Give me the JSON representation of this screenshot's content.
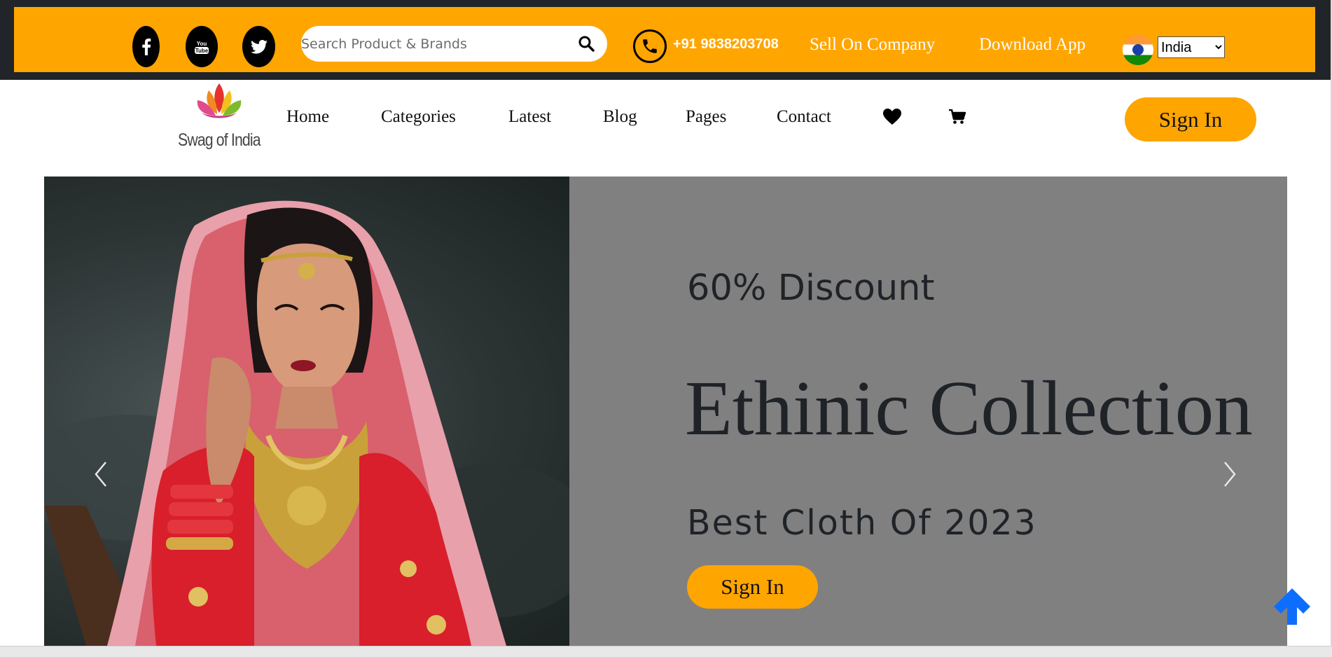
{
  "topbar": {
    "social": [
      {
        "name": "facebook-icon"
      },
      {
        "name": "youtube-icon"
      },
      {
        "name": "twitter-icon"
      }
    ],
    "search_placeholder": "Search Product & Brands",
    "search_value": "",
    "search_icon": "search-icon",
    "phone_icon": "phone-icon",
    "phone_number": "+91 9838203708",
    "sell_link": "Sell On Company",
    "download_link": "Download App",
    "country_flag": "india-flag-icon",
    "country_selected": "India",
    "accent_color": "#ffa500"
  },
  "nav": {
    "logo_text": "Swag of India",
    "items": [
      {
        "label": "Home"
      },
      {
        "label": "Categories"
      },
      {
        "label": "Latest"
      },
      {
        "label": "Blog"
      },
      {
        "label": "Pages"
      },
      {
        "label": "Contact"
      }
    ],
    "wishlist_icon": "heart-icon",
    "cart_icon": "cart-icon",
    "signin_label": "Sign In"
  },
  "hero": {
    "discount": "60% Discount",
    "title": "Ethinic Collection",
    "subtitle": "Best Cloth Of 2023",
    "cta_label": "Sign In",
    "panel_color": "#808080",
    "prev_icon": "chevron-left-icon",
    "next_icon": "chevron-right-icon"
  },
  "scroll_top_icon": "arrow-up-icon",
  "scroll_top_color": "#0d6efd"
}
